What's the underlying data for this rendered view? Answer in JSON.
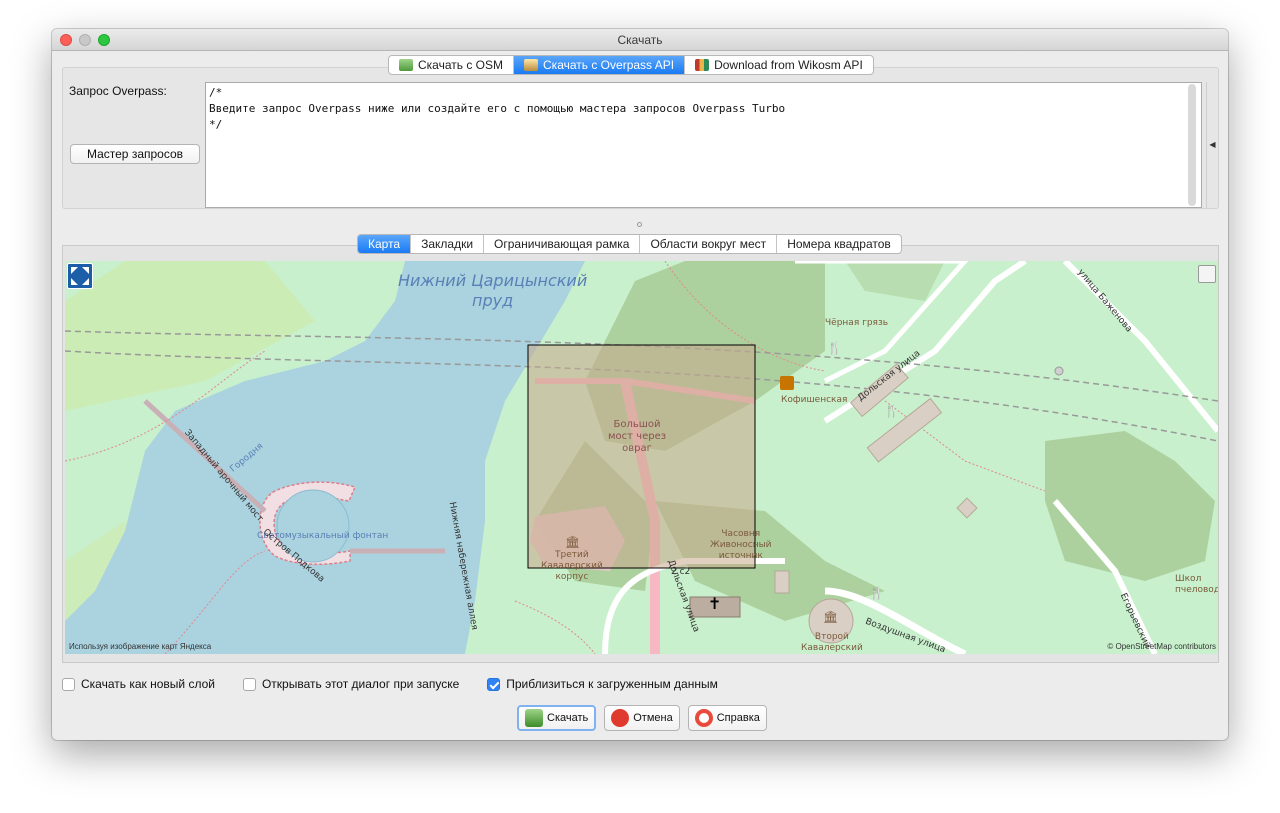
{
  "window": {
    "title": "Скачать"
  },
  "source_tabs": [
    {
      "label": "Скачать с OSM",
      "active": false,
      "icon": "osm-download-icon"
    },
    {
      "label": "Скачать с Overpass API",
      "active": true,
      "icon": "overpass-download-icon"
    },
    {
      "label": "Download from Wikosm API",
      "active": false,
      "icon": "wikosm-download-icon"
    }
  ],
  "query": {
    "label": "Запрос Overpass:",
    "value": "/*\nВведите запрос Overpass ниже или создайте его с помощью мастера запросов Overpass Turbo\n*/",
    "wizard_button": "Мастер запросов"
  },
  "map_tabs": [
    {
      "label": "Карта",
      "active": true
    },
    {
      "label": "Закладки",
      "active": false
    },
    {
      "label": "Ограничивающая рамка",
      "active": false
    },
    {
      "label": "Области вокруг мест",
      "active": false
    },
    {
      "label": "Номера квадратов",
      "active": false
    }
  ],
  "map": {
    "labels": {
      "pond": "Нижний Царицынский\nпруд",
      "bridge": "Большой\nмост через\nовраг",
      "fountain": "Светомузыкальный\nфонтан",
      "island": "Остров Подкова",
      "arched_bridge": "Западный арочный мост",
      "gorodnya": "Городня",
      "embankment": "Нижняя набережная аллея",
      "chernaya_gryaz": "Чёрная грязь",
      "kofishenskaya": "Кофишенская",
      "dolskaya1": "Дольская улица",
      "dolskaya2": "Дольская улица",
      "bazhenova": "улица Баженова",
      "vozdushnaya": "Воздушная улица",
      "yegotyevskiy": "Егорьевский",
      "chapel": "Часовня\nЖивоносный\nисточник",
      "third_corps": "Третий\nКавалерский\nкорпус",
      "second_corps": "Второй\nКавалерский",
      "school": "Школ\nпчеловод",
      "building_number": "2 с2"
    },
    "attribution_left": "Используя изображение карт Яндекса",
    "attribution_right": "© OpenStreetMap contributors"
  },
  "options": [
    {
      "label": "Скачать как новый слой",
      "checked": false
    },
    {
      "label": "Открывать этот диалог при запуске",
      "checked": false
    },
    {
      "label": "Приблизиться к загруженным данным",
      "checked": true
    }
  ],
  "buttons": {
    "download": "Скачать",
    "cancel": "Отмена",
    "help": "Справка"
  },
  "colors": {
    "accent": "#1a7bf4",
    "water": "#aad3df",
    "forest": "#add19e",
    "park": "#c8f0cc",
    "selection": "#c8a88c"
  }
}
